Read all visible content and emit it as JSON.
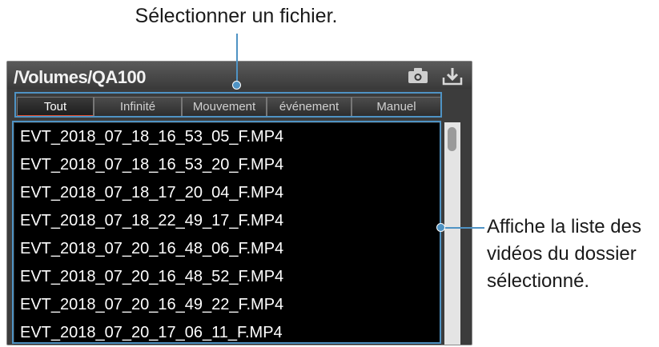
{
  "callouts": {
    "top": "Sélectionner un fichier.",
    "right_lines": [
      "Affiche la liste des",
      "vidéos du dossier",
      "sélectionné."
    ]
  },
  "window": {
    "path_title": "/Volumes/QA100",
    "icons": [
      "camera-icon",
      "download-icon"
    ]
  },
  "tabs": [
    {
      "label": "Tout",
      "active": true
    },
    {
      "label": "Infinité",
      "active": false
    },
    {
      "label": "Mouvement",
      "active": false
    },
    {
      "label": "événement",
      "active": false
    },
    {
      "label": "Manuel",
      "active": false
    }
  ],
  "files": [
    "EVT_2018_07_18_16_53_05_F.MP4",
    "EVT_2018_07_18_16_53_20_F.MP4",
    "EVT_2018_07_18_17_20_04_F.MP4",
    "EVT_2018_07_18_22_49_17_F.MP4",
    "EVT_2018_07_20_16_48_06_F.MP4",
    "EVT_2018_07_20_16_48_52_F.MP4",
    "EVT_2018_07_20_16_49_22_F.MP4",
    "EVT_2018_07_20_17_06_11_F.MP4"
  ],
  "colors": {
    "accent_tab_underline": "#e24a2c",
    "callout_line": "#4f93c4"
  }
}
